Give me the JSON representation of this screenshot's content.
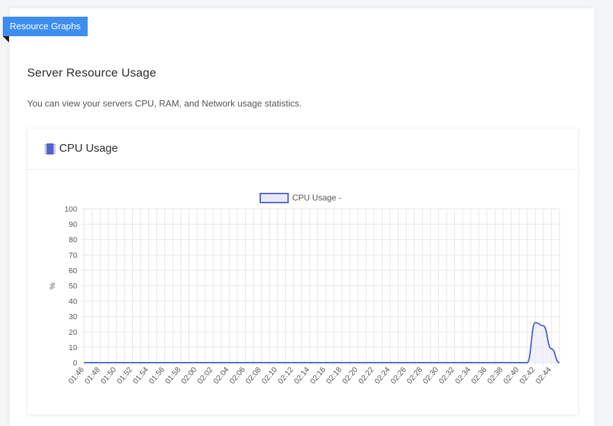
{
  "ribbon": {
    "label": "Resource Graphs"
  },
  "section": {
    "title": "Server Resource Usage",
    "description": "You can view your servers CPU, RAM, and Network usage statistics."
  },
  "card": {
    "title": "CPU Usage",
    "icon": "cpu-chip-icon"
  },
  "colors": {
    "accent": "#3d8ef0",
    "series": "#5563c8",
    "fill": "#e8eafb"
  },
  "chart_data": {
    "type": "line",
    "legend": "CPU Usage -",
    "legend_position": "top",
    "ylabel": "%",
    "ylim": [
      0,
      100
    ],
    "yticks": [
      0,
      10,
      20,
      30,
      40,
      50,
      60,
      70,
      80,
      90,
      100
    ],
    "grid": true,
    "x": [
      "01:46",
      "01:47",
      "01:48",
      "01:49",
      "01:50",
      "01:51",
      "01:52",
      "01:53",
      "01:54",
      "01:55",
      "01:56",
      "01:57",
      "01:58",
      "01:59",
      "02:00",
      "02:01",
      "02:02",
      "02:03",
      "02:04",
      "02:05",
      "02:06",
      "02:07",
      "02:08",
      "02:09",
      "02:10",
      "02:11",
      "02:12",
      "02:13",
      "02:14",
      "02:15",
      "02:16",
      "02:17",
      "02:18",
      "02:19",
      "02:20",
      "02:21",
      "02:22",
      "02:23",
      "02:24",
      "02:25",
      "02:26",
      "02:27",
      "02:28",
      "02:29",
      "02:30",
      "02:31",
      "02:32",
      "02:33",
      "02:34",
      "02:35",
      "02:36",
      "02:37",
      "02:38",
      "02:39",
      "02:40",
      "02:41",
      "02:42",
      "02:43",
      "02:44",
      "02:45"
    ],
    "x_tick_labels": [
      "01:46",
      "01:48",
      "01:50",
      "01:52",
      "01:54",
      "01:56",
      "01:58",
      "02:00",
      "02:02",
      "02:04",
      "02:06",
      "02:08",
      "02:10",
      "02:12",
      "02:14",
      "02:16",
      "02:18",
      "02:20",
      "02:22",
      "02:24",
      "02:26",
      "02:28",
      "02:30",
      "02:32",
      "02:34",
      "02:36",
      "02:38",
      "02:40",
      "02:42",
      "02:44"
    ],
    "series": [
      {
        "name": "CPU Usage -",
        "values": [
          0,
          0,
          0,
          0,
          0,
          0,
          0,
          0,
          0,
          0,
          0,
          0,
          0,
          0,
          0,
          0,
          0,
          0,
          0,
          0,
          0,
          0,
          0,
          0,
          0,
          0,
          0,
          0,
          0,
          0,
          0,
          0,
          0,
          0,
          0,
          0,
          0,
          0,
          0,
          0,
          0,
          0,
          0,
          0,
          0,
          0,
          0,
          0,
          0,
          0,
          0,
          0,
          0,
          0,
          0,
          0,
          26,
          24,
          9,
          0
        ]
      }
    ]
  }
}
